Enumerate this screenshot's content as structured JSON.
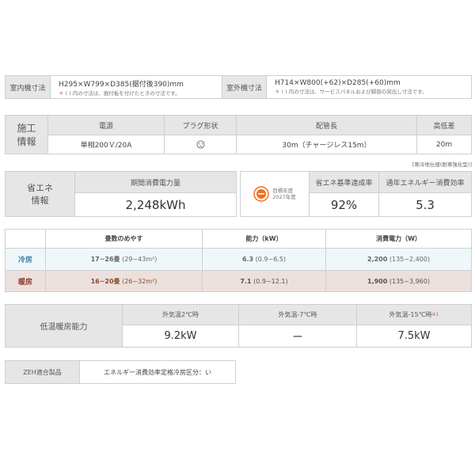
{
  "dimensions": {
    "indoor_label": "室内機寸法",
    "indoor_value": "H295×W799×D385(据付後390)mm",
    "indoor_note_mark": "＊",
    "indoor_note": "( ) 内の寸法は、据付板を付けたときの寸法です。",
    "outdoor_label": "室外機寸法",
    "outdoor_value": "H714×W800(+62)×D285(+60)mm",
    "outdoor_note_mark": "＊",
    "outdoor_note": "( ) 内の寸法は、サービスパネルおよび脚部の突出し寸法です。"
  },
  "install": {
    "label_1": "施工",
    "label_2": "情報",
    "headers": [
      "電源",
      "プラグ形状",
      "配管長",
      "高低差"
    ],
    "values": [
      "単相200Ｖ/20A",
      "",
      "30m（チャージレス15m）",
      "20m"
    ],
    "plug_icon": "plug-outlet-icon"
  },
  "spec_note": "[寒冷地仕様(耐寒強化型)]",
  "energy": {
    "label_1": "省エネ",
    "label_2": "情報",
    "period_header": "期間消費電力量",
    "period_value": "2,248kWh",
    "logo_text_1": "目標年度",
    "logo_text_2": "2027年度",
    "logo_color": "#f07020",
    "rate_header": "省エネ基準達成率",
    "rate_value": "92%",
    "apf_header": "通年エネルギー消費効率",
    "apf_value": "5.3"
  },
  "capacity": {
    "headers": [
      "",
      "畳数のめやす",
      "能力（kW）",
      "消費電力（W）"
    ],
    "rows": [
      {
        "mode": "冷房",
        "tatami": "17~26畳",
        "area": "(29~43m²)",
        "power": "6.3",
        "power_range": "(0.9~6.5)",
        "consumption": "2,200",
        "consumption_range": "(135~2,400)"
      },
      {
        "mode": "暖房",
        "tatami": "16~20畳",
        "area": "(26~32m²)",
        "power": "7.1",
        "power_range": "(0.9~12.1)",
        "consumption": "1,900",
        "consumption_range": "(135~3,960)"
      }
    ]
  },
  "low_temp": {
    "label": "低温暖房能力",
    "headers": [
      "外気温2℃時",
      "外気温-7℃時",
      "外気温-15℃時"
    ],
    "footnote_mark": "※1",
    "values": [
      "9.2kW",
      "ー",
      "7.5kW"
    ]
  },
  "zeh": {
    "label": "ZEH適合製品",
    "value": "エネルギー消費効率定格冷房区分：い"
  }
}
